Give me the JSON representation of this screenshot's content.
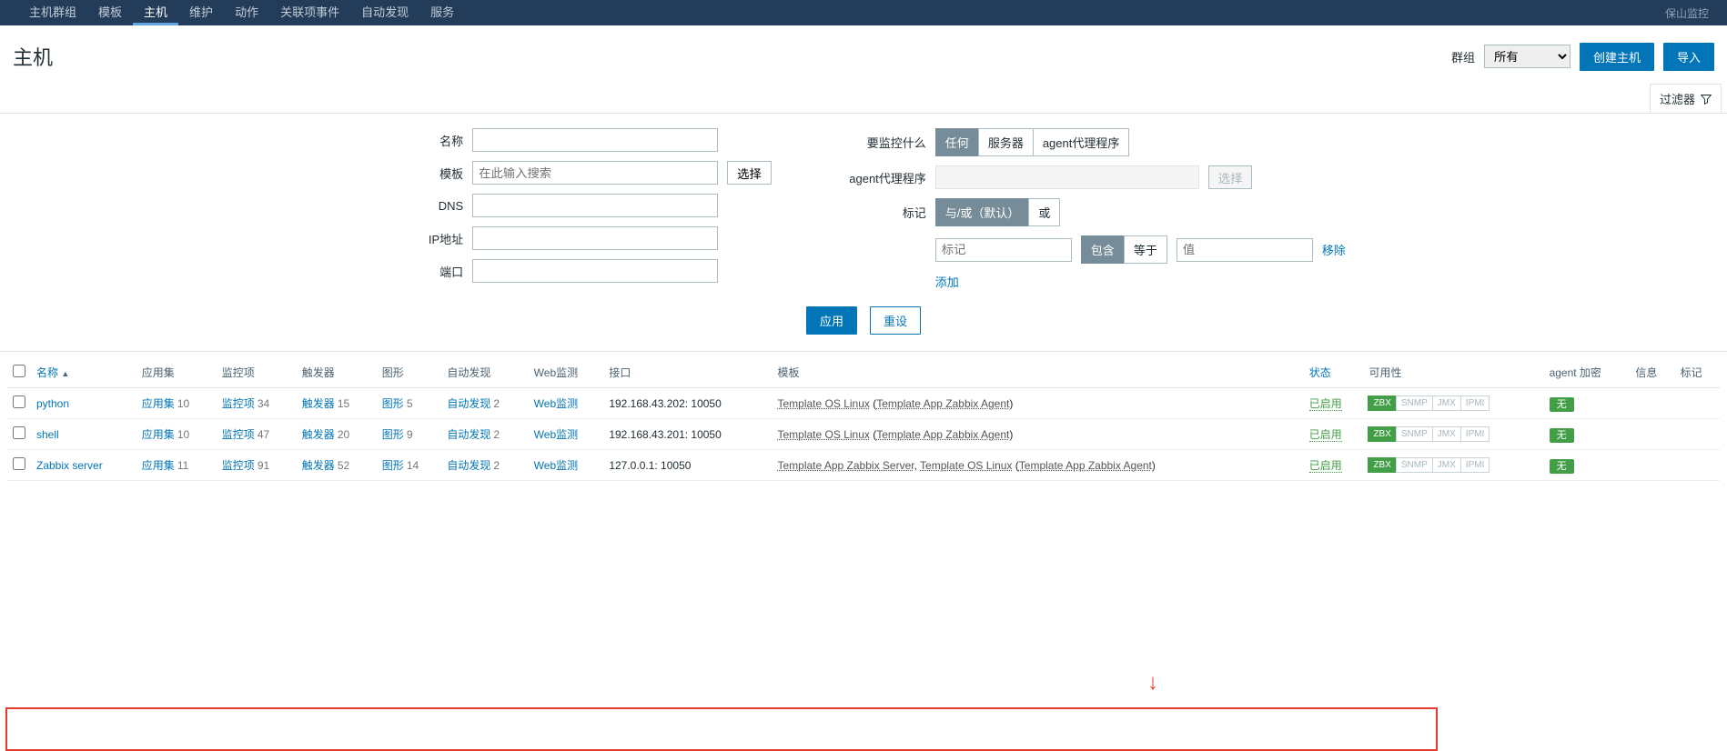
{
  "topnav": {
    "items": [
      "主机群组",
      "模板",
      "主机",
      "维护",
      "动作",
      "关联项事件",
      "自动发现",
      "服务"
    ],
    "active_index": 2,
    "right_text": "保山监控"
  },
  "header": {
    "title": "主机",
    "group_label": "群组",
    "group_value": "所有",
    "create_btn": "创建主机",
    "import_btn": "导入"
  },
  "filter_tab": "过滤器",
  "filter_left": {
    "name_label": "名称",
    "template_label": "模板",
    "template_placeholder": "在此输入搜索",
    "select_btn": "选择",
    "dns_label": "DNS",
    "ip_label": "IP地址",
    "port_label": "端口"
  },
  "filter_right": {
    "monitor_label": "要监控什么",
    "monitor_opts": [
      "任何",
      "服务器",
      "agent代理程序"
    ],
    "proxy_label": "agent代理程序",
    "proxy_select": "选择",
    "tag_label": "标记",
    "tag_logic_opts": [
      "与/或（默认）",
      "或"
    ],
    "tag_key_placeholder": "标记",
    "tag_op_opts": [
      "包含",
      "等于"
    ],
    "tag_val_placeholder": "值",
    "remove": "移除",
    "add": "添加"
  },
  "filter_actions": {
    "apply": "应用",
    "reset": "重设"
  },
  "table": {
    "headers": [
      "",
      "名称",
      "应用集",
      "监控项",
      "触发器",
      "图形",
      "自动发现",
      "Web监测",
      "接口",
      "模板",
      "状态",
      "可用性",
      "agent 加密",
      "信息",
      "标记"
    ],
    "rows": [
      {
        "name": "python",
        "app": {
          "label": "应用集",
          "n": 10
        },
        "item": {
          "label": "监控项",
          "n": 34
        },
        "trig": {
          "label": "触发器",
          "n": 15
        },
        "graph": {
          "label": "图形",
          "n": 5
        },
        "disc": {
          "label": "自动发现",
          "n": 2
        },
        "web": {
          "label": "Web监测"
        },
        "iface": "192.168.43.202: 10050",
        "tpl_main": "Template OS Linux",
        "tpl_sub": "Template App Zabbix Agent",
        "status": "已启用",
        "enc": "无"
      },
      {
        "name": "shell",
        "app": {
          "label": "应用集",
          "n": 10
        },
        "item": {
          "label": "监控项",
          "n": 47
        },
        "trig": {
          "label": "触发器",
          "n": 20
        },
        "graph": {
          "label": "图形",
          "n": 9
        },
        "disc": {
          "label": "自动发现",
          "n": 2
        },
        "web": {
          "label": "Web监测"
        },
        "iface": "192.168.43.201: 10050",
        "tpl_main": "Template OS Linux",
        "tpl_sub": "Template App Zabbix Agent",
        "status": "已启用",
        "enc": "无"
      },
      {
        "name": "Zabbix server",
        "app": {
          "label": "应用集",
          "n": 11
        },
        "item": {
          "label": "监控项",
          "n": 91
        },
        "trig": {
          "label": "触发器",
          "n": 52
        },
        "graph": {
          "label": "图形",
          "n": 14
        },
        "disc": {
          "label": "自动发现",
          "n": 2
        },
        "web": {
          "label": "Web监测"
        },
        "iface": "127.0.0.1: 10050",
        "tpl_main2": "Template App Zabbix Server",
        "tpl_main": "Template OS Linux",
        "tpl_sub": "Template App Zabbix Agent",
        "status": "已启用",
        "enc": "无"
      }
    ],
    "avail_labels": [
      "ZBX",
      "SNMP",
      "JMX",
      "IPMI"
    ]
  }
}
